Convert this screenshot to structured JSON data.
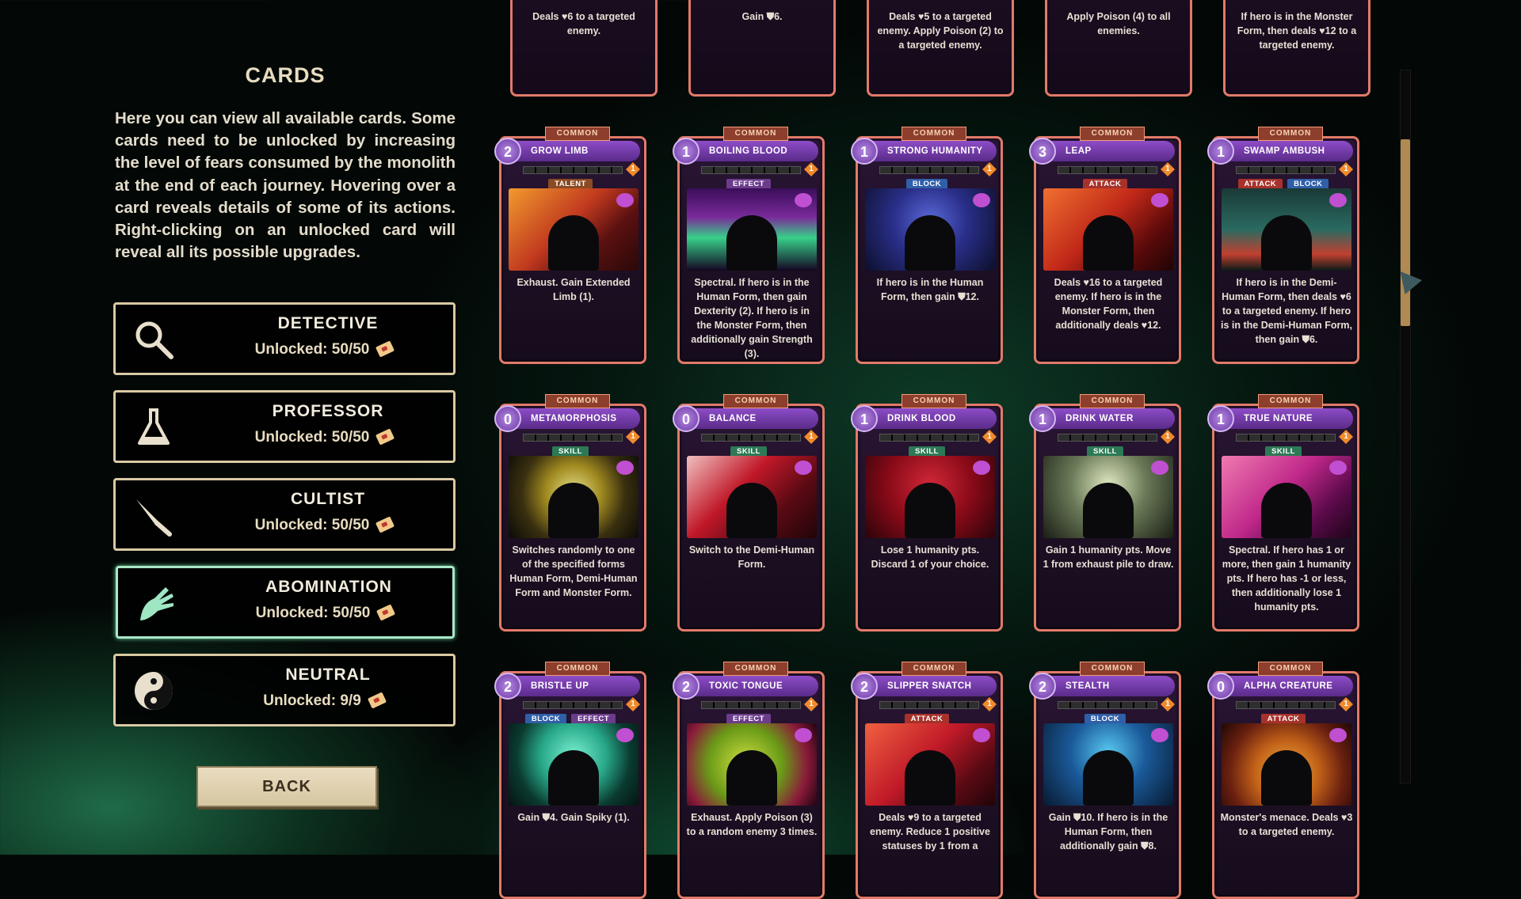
{
  "screen": {
    "title": "CARDS",
    "description": "Here you can view all available cards. Some cards need to be unlocked by increasing the level of fears consumed by the monolith at the end of each journey. Hovering over a card reveals details of some of its actions. Right-clicking on an unlocked card will reveal all its possible upgrades."
  },
  "categories": [
    {
      "name": "DETECTIVE",
      "unlocked": "Unlocked: 50/50",
      "icon": "magnifier-icon"
    },
    {
      "name": "PROFESSOR",
      "unlocked": "Unlocked: 50/50",
      "icon": "flask-icon"
    },
    {
      "name": "CULTIST",
      "unlocked": "Unlocked: 50/50",
      "icon": "knife-icon"
    },
    {
      "name": "ABOMINATION",
      "unlocked": "Unlocked: 50/50",
      "icon": "claw-icon",
      "active": true
    },
    {
      "name": "NEUTRAL",
      "unlocked": "Unlocked: 9/9",
      "icon": "yin-yang-icon"
    }
  ],
  "back_label": "BACK",
  "partial_row": [
    {
      "text": "Deals ♥6 to a targeted enemy."
    },
    {
      "text": "Gain ⛊6."
    },
    {
      "text": "Deals ♥5 to a targeted enemy. Apply Poison (2) to a targeted enemy."
    },
    {
      "text": "Apply Poison (4) to all enemies."
    },
    {
      "text": "If hero is in the Monster Form, then deals ♥12 to a targeted enemy."
    }
  ],
  "cards": [
    {
      "rarity": "COMMON",
      "cost": "2",
      "name": "GROW LIMB",
      "types": [
        "TALENT"
      ],
      "level": "1",
      "text": "Exhaust. Gain Extended Limb (1).",
      "art": "linear-gradient(135deg,#f29a2e,#c0391f 45%,#5a1010 70%,#2a0808)"
    },
    {
      "rarity": "COMMON",
      "cost": "1",
      "name": "BOILING BLOOD",
      "types": [
        "EFFECT"
      ],
      "level": "1",
      "text": "Spectral. If hero is in the Human Form, then gain Dexterity (2). If hero is in the Monster Form, then additionally gain Strength (3).",
      "art": "linear-gradient(180deg,#3a0e5a,#7a2a9a 35%,#38d08a 60%,#140622)"
    },
    {
      "rarity": "COMMON",
      "cost": "1",
      "name": "STRONG HUMANITY",
      "types": [
        "BLOCK"
      ],
      "level": "1",
      "text": "If hero is in the Human Form, then gain ⛊12.",
      "art": "radial-gradient(circle at 50% 40%,#5a6ad8,#2a2f8a 45%,#0c0f2a)"
    },
    {
      "rarity": "COMMON",
      "cost": "3",
      "name": "LEAP",
      "types": [
        "ATTACK"
      ],
      "level": "1",
      "text": "Deals ♥16 to a targeted enemy. If hero is in the Monster Form, then additionally deals ♥12.",
      "art": "linear-gradient(135deg,#f07030,#c02818 45%,#5a0a0a 75%,#200404)"
    },
    {
      "rarity": "COMMON",
      "cost": "1",
      "name": "SWAMP AMBUSH",
      "types": [
        "ATTACK",
        "BLOCK"
      ],
      "level": "1",
      "text": "If hero is in the Demi-Human Form, then deals ♥6 to a targeted enemy. If hero is in the Demi-Human Form, then gain ⛊6.",
      "art": "linear-gradient(180deg,#1a3a36,#2a6a60 50%,#c04030 80%,#0a1a18)"
    },
    {
      "rarity": "COMMON",
      "cost": "0",
      "name": "METAMORPHOSIS",
      "types": [
        "SKILL"
      ],
      "level": "1",
      "text": "Switches randomly to one of the specified forms Human Form, Demi-Human Form and Monster Form.",
      "art": "radial-gradient(circle at 50% 45%,#e6e08a,#a08a20 35%,#3a3010 65%,#0a0a06)"
    },
    {
      "rarity": "COMMON",
      "cost": "0",
      "name": "BALANCE",
      "types": [
        "SKILL"
      ],
      "level": "1",
      "text": "Switch to the Demi-Human Form.",
      "art": "linear-gradient(135deg,#f0c0c0,#c01828 40%,#5a0a14 70%,#200408)"
    },
    {
      "rarity": "COMMON",
      "cost": "1",
      "name": "DRINK BLOOD",
      "types": [
        "SKILL"
      ],
      "level": "1",
      "text": "Lose 1 humanity pts. Discard 1 of your choice.",
      "art": "radial-gradient(circle at 50% 35%,#d02838,#8a0a18 50%,#2a040a)"
    },
    {
      "rarity": "COMMON",
      "cost": "1",
      "name": "DRINK WATER",
      "types": [
        "SKILL"
      ],
      "level": "1",
      "text": "Gain 1 humanity pts. Move 1 from exhaust pile to draw.",
      "art": "radial-gradient(circle at 50% 35%,#e0e8c0,#6a7a58 45%,#1a1e14)"
    },
    {
      "rarity": "COMMON",
      "cost": "1",
      "name": "TRUE NATURE",
      "types": [
        "SKILL"
      ],
      "level": "1",
      "text": "Spectral. If hero has 1 or more, then gain 1 humanity pts. If hero has -1 or less, then additionally lose 1 humanity pts.",
      "art": "linear-gradient(135deg,#f07ab0,#c0288a 45%,#5a0a4a 75%,#200418)"
    },
    {
      "rarity": "COMMON",
      "cost": "2",
      "name": "BRISTLE UP",
      "types": [
        "BLOCK",
        "EFFECT"
      ],
      "level": "1",
      "text": "Gain ⛊4. Gain Spiky (1).",
      "art": "radial-gradient(circle at 50% 40%,#7af0d0,#28a888 40%,#0a3a30 70%,#041410)"
    },
    {
      "rarity": "COMMON",
      "cost": "2",
      "name": "TOXIC TONGUE",
      "types": [
        "EFFECT"
      ],
      "level": "1",
      "text": "Exhaust. Apply Poison (3) to a random enemy 3 times.",
      "art": "radial-gradient(circle at 45% 50%,#d0e040,#6a9a18 45%,#8a1a3a 75%,#200410)"
    },
    {
      "rarity": "COMMON",
      "cost": "2",
      "name": "SLIPPER SNATCH",
      "types": [
        "ATTACK"
      ],
      "level": "1",
      "text": "Deals ♥9 to a targeted enemy. Reduce 1 positive statuses by 1 from a",
      "art": "linear-gradient(135deg,#f06040,#c01a28 45%,#5a0a14 75%,#200408)"
    },
    {
      "rarity": "COMMON",
      "cost": "2",
      "name": "STEALTH",
      "types": [
        "BLOCK"
      ],
      "level": "1",
      "text": "Gain ⛊10. If hero is in the Human Form, then additionally gain ⛊8.",
      "art": "radial-gradient(circle at 50% 35%,#58c8f0,#1a5a9a 45%,#081a30)"
    },
    {
      "rarity": "COMMON",
      "cost": "0",
      "name": "ALPHA CREATURE",
      "types": [
        "ATTACK"
      ],
      "level": "1",
      "text": "Monster's menace. Deals ♥3 to a targeted enemy.",
      "art": "radial-gradient(circle at 50% 60%,#f0b040,#c06018 40%,#6a2010 70%,#200804)"
    }
  ]
}
